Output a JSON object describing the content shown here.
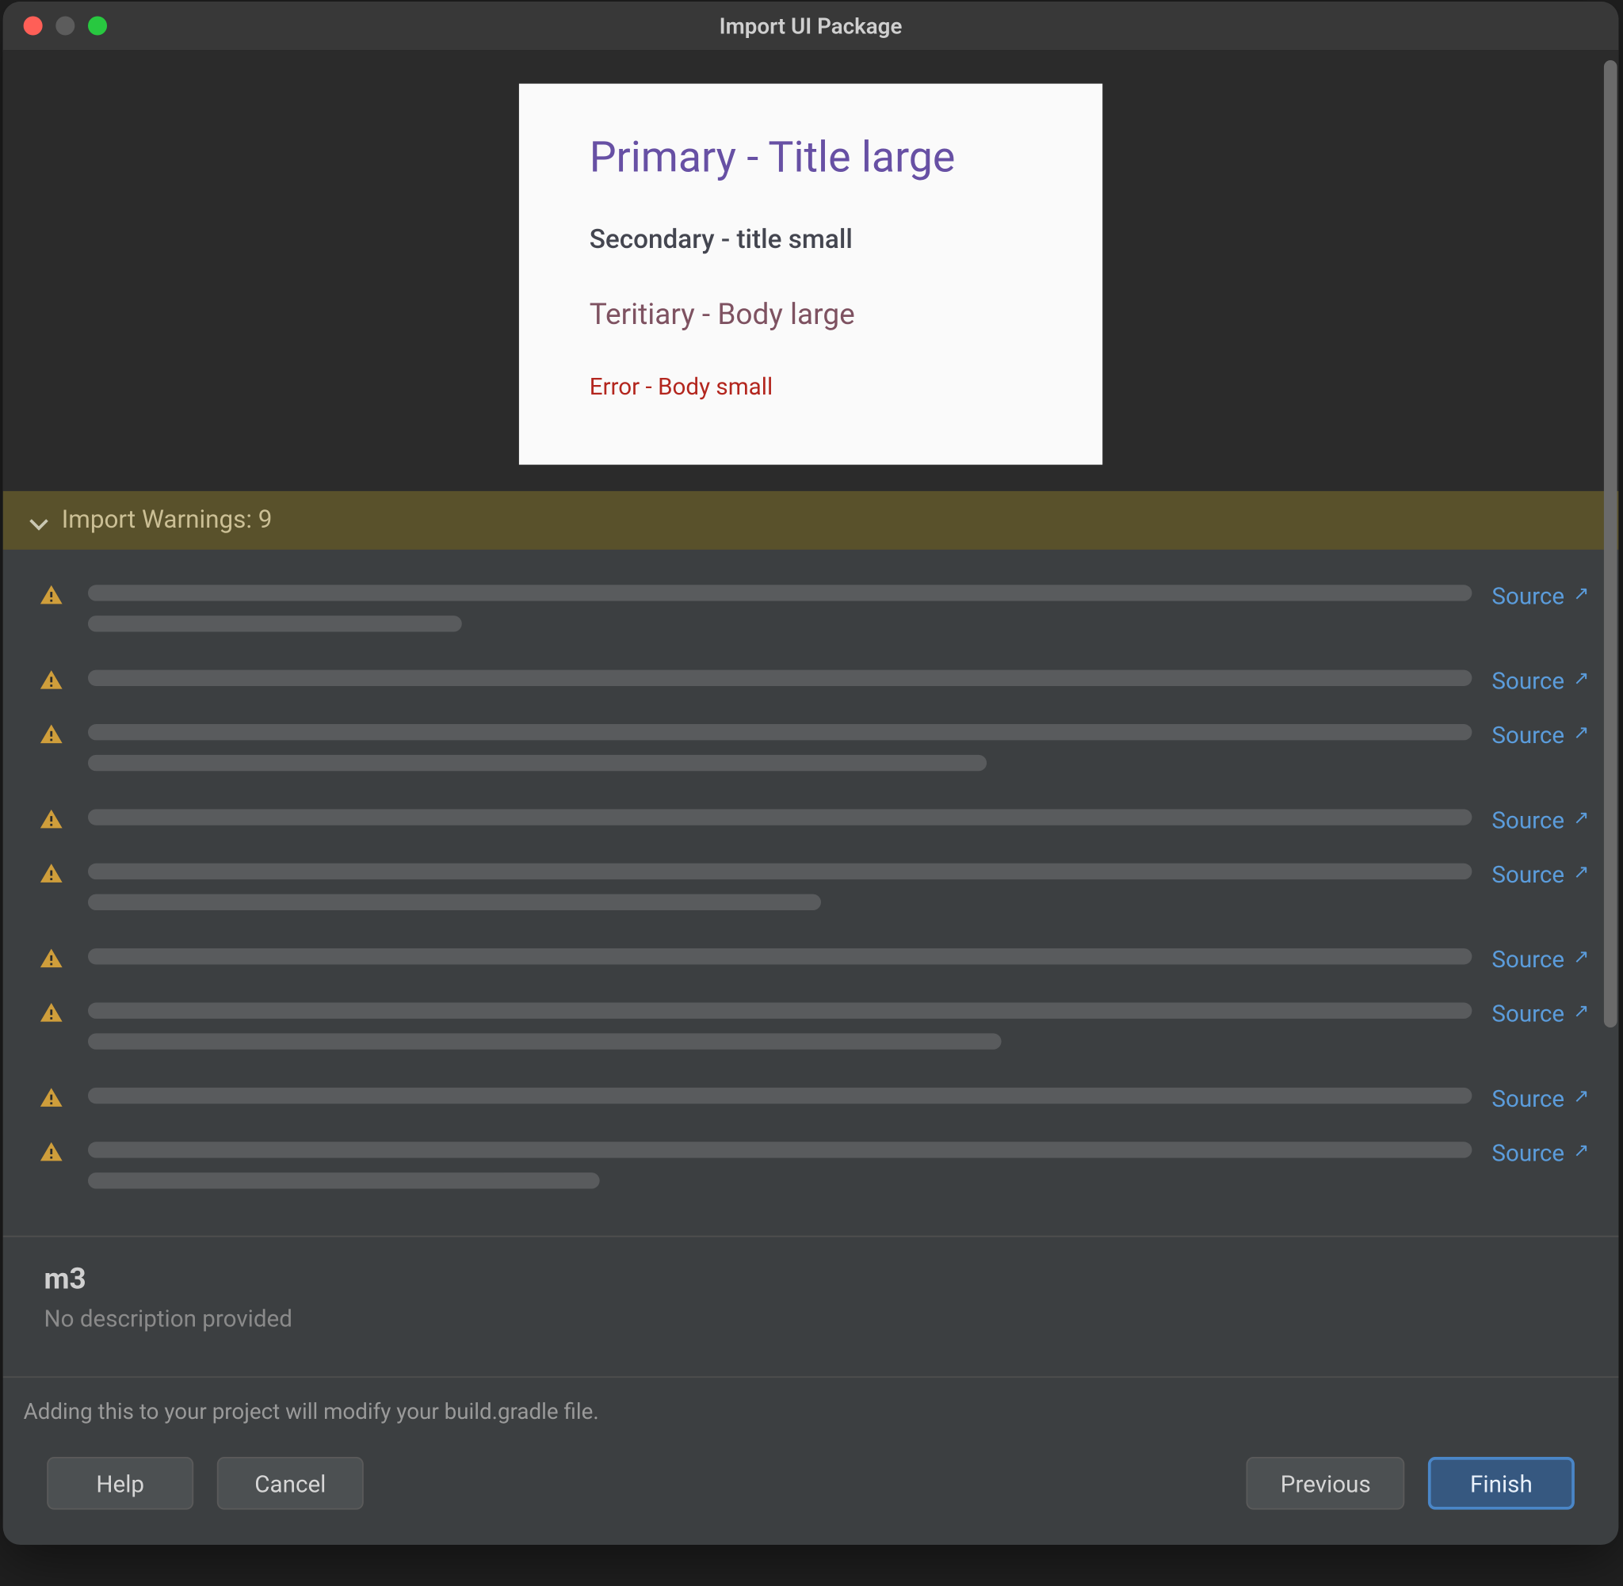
{
  "window": {
    "title": "Import UI Package"
  },
  "preview": {
    "primary": "Primary - Title large",
    "secondary": "Secondary - title small",
    "tertiary": "Teritiary - Body large",
    "error": "Error - Body small"
  },
  "warnings": {
    "header_label": "Import Warnings: 9",
    "count": 9,
    "source_label": "Source",
    "items": [
      {
        "lines": [
          100,
          27
        ]
      },
      {
        "lines": [
          100
        ]
      },
      {
        "lines": [
          100,
          65
        ]
      },
      {
        "lines": [
          100
        ]
      },
      {
        "lines": [
          100,
          53
        ]
      },
      {
        "lines": [
          100
        ]
      },
      {
        "lines": [
          100,
          66
        ]
      },
      {
        "lines": [
          100
        ]
      },
      {
        "lines": [
          100,
          37
        ]
      }
    ]
  },
  "info": {
    "title": "m3",
    "description": "No description provided"
  },
  "footer": {
    "note": "Adding this to your project will modify your build.gradle file.",
    "help": "Help",
    "cancel": "Cancel",
    "previous": "Previous",
    "finish": "Finish"
  }
}
